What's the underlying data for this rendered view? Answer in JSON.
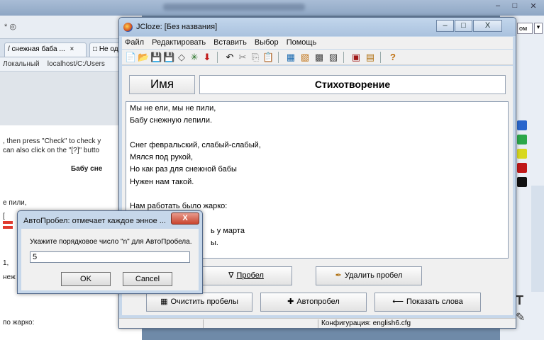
{
  "background_browser": {
    "close_glyph": "×",
    "tab1_label": "/ снежная баба ...",
    "tab2_label": "Не одна",
    "bookmark1": "Локальный",
    "bookmark2": "localhost/C:/Users",
    "instr1": ", then press \"Check\" to check y",
    "instr2": "can also click on the \"[?]\" butto",
    "heading": "Бабу сне",
    "frag1": "е пили,",
    "frag2": "[",
    "frag3": "1,",
    "frag4": "неж",
    "frag5": "по жарко:"
  },
  "window": {
    "title": "JCloze: [Без названия]",
    "minimize": "–",
    "maximize": "□",
    "close": "X"
  },
  "menu": [
    "Файл",
    "Редактировать",
    "Вставить",
    "Выбор",
    "Помощь"
  ],
  "toolbar": {
    "new": "📄",
    "open": "📂",
    "save": "💾",
    "save_as": "💾",
    "clear": "◇",
    "web": "✳",
    "down": "⬇",
    "undo": "↶",
    "cut": "✂",
    "copy": "⎘",
    "paste": "📋",
    "t1": "▦",
    "t2": "▧",
    "t3": "▩",
    "t4": "▨",
    "t5": "▣",
    "t6": "▤",
    "help": "?"
  },
  "editor": {
    "name_label": "Имя",
    "title_value": "Стихотворение",
    "lines": [
      "Мы не ели, мы не пили,",
      "Бабу снежную лепили.",
      "",
      "Снег февральский, слабый-слабый,",
      "Мялся под рукой,",
      "Но как раз для снежной бабы",
      "Нужен нам такой.",
      "",
      "Нам работать было жарко:",
      "",
      "ь у марта",
      "ы."
    ]
  },
  "buttons": {
    "gap": "Пробел",
    "delete_gap": "Удалить пробел",
    "clear_gaps": "Очистить пробелы",
    "autogap": "Автопробел",
    "show_words": "Показать слова"
  },
  "status": {
    "config": "Конфигурация: english6.cfg"
  },
  "dialog": {
    "title": "АвтоПробел: отмечает каждое энное ...",
    "close": "X",
    "prompt": "Укажите порядковое число \"n\" для АвтоПробела.",
    "value": "5",
    "ok": "OK",
    "cancel": "Cancel"
  },
  "right_app": {
    "ctrl1": "ом",
    "ctrl2": "▾",
    "text_tool": "T",
    "pencil": "✎"
  }
}
